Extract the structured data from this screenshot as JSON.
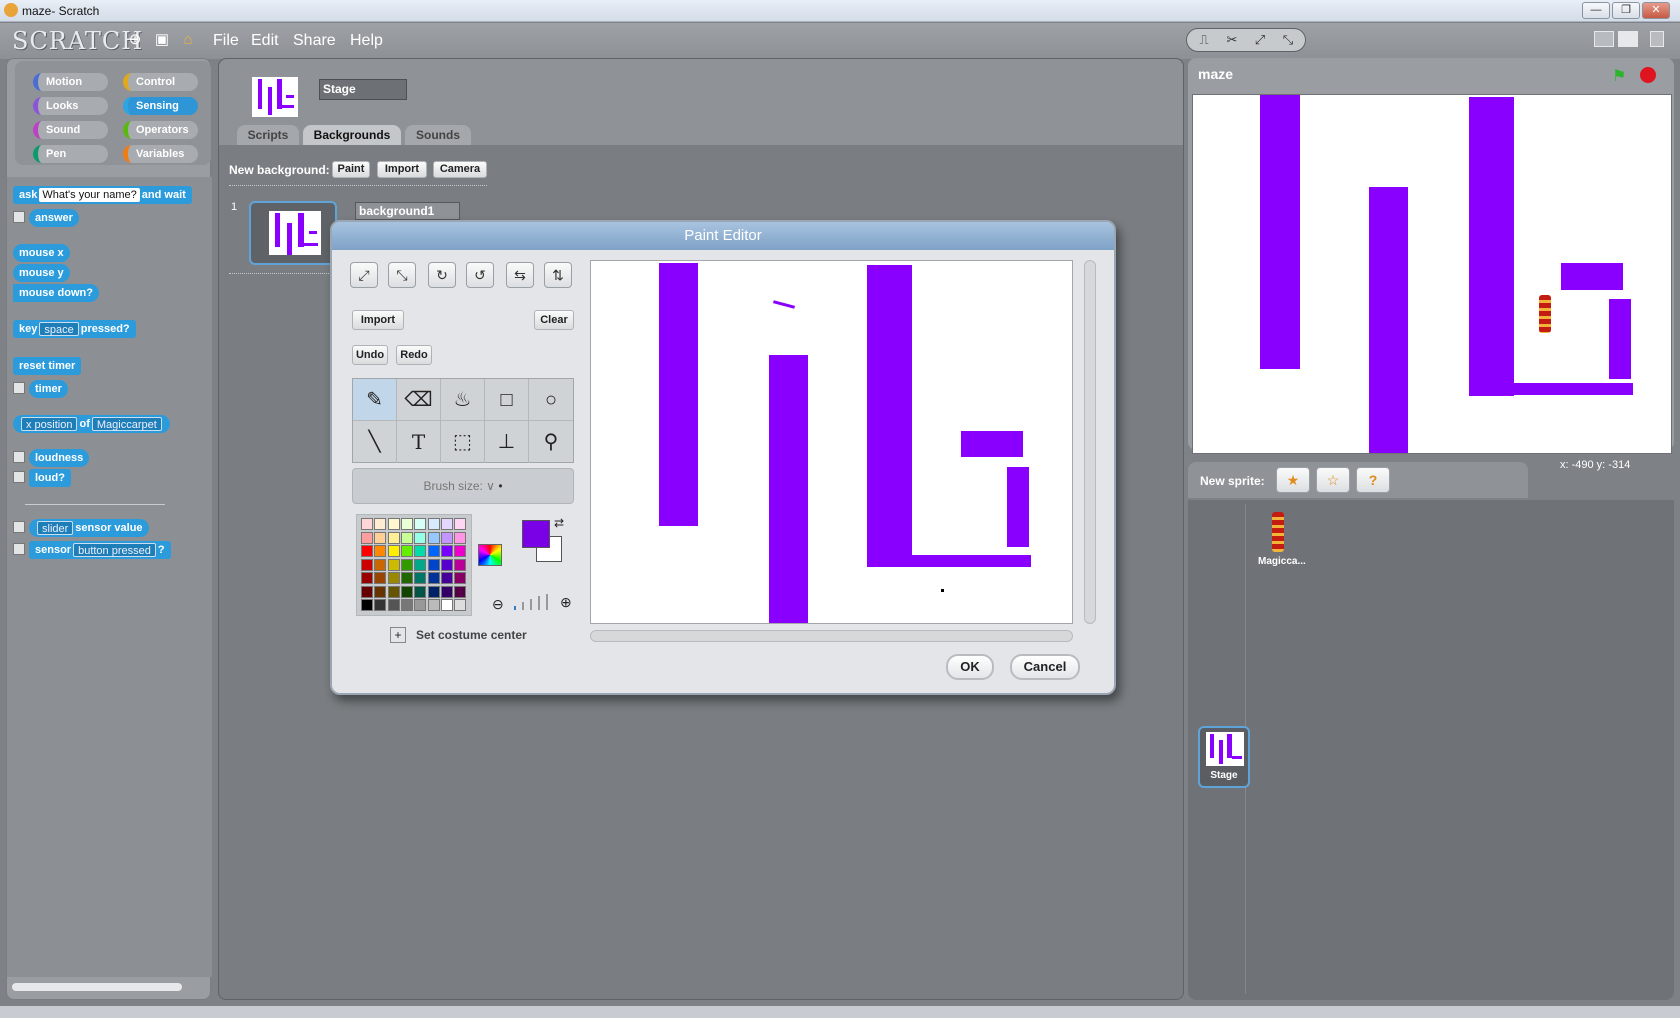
{
  "window": {
    "title": "maze- Scratch",
    "min": "—",
    "max": "❐",
    "close": "✕"
  },
  "menu": {
    "logo": "SCRATCH",
    "items": [
      "File",
      "Edit",
      "Share",
      "Help"
    ],
    "icons": [
      "globe-icon",
      "save-icon",
      "share-icon"
    ],
    "tools": [
      "stamp-icon",
      "cut-icon",
      "grow-icon",
      "shrink-icon"
    ]
  },
  "categories": [
    {
      "label": "Motion",
      "color": "#4a6cd4"
    },
    {
      "label": "Control",
      "color": "#e1a91a"
    },
    {
      "label": "Looks",
      "color": "#8a55d7"
    },
    {
      "label": "Sensing",
      "color": "#2ca5e2"
    },
    {
      "label": "Sound",
      "color": "#bb42c3"
    },
    {
      "label": "Operators",
      "color": "#5cb712"
    },
    {
      "label": "Pen",
      "color": "#0e9a6c"
    },
    {
      "label": "Variables",
      "color": "#ee7d16"
    }
  ],
  "blocks": {
    "ask": "ask",
    "ask_default": "What's your name?",
    "and_wait": "and wait",
    "answer": "answer",
    "mouse_x": "mouse x",
    "mouse_y": "mouse y",
    "mouse_down": "mouse down?",
    "key": "key",
    "key_opt": "space",
    "pressed": "pressed?",
    "reset_timer": "reset timer",
    "timer": "timer",
    "attr_opt": "x position",
    "of": "of",
    "sprite_opt": "Magiccarpet",
    "loudness": "loudness",
    "loud": "loud?",
    "slider_opt": "slider",
    "sensor_value": "sensor value",
    "sensor": "sensor",
    "sensor_opt": "button pressed",
    "question": "?"
  },
  "center": {
    "stage_name": "Stage",
    "tabs": [
      "Scripts",
      "Backgrounds",
      "Sounds"
    ],
    "active_tab": "Backgrounds",
    "new_background_label": "New background:",
    "new_bg_buttons": [
      "Paint",
      "Import",
      "Camera"
    ],
    "costume_number": "1",
    "costume_name": "background1"
  },
  "editor": {
    "title": "Paint Editor",
    "import": "Import",
    "clear": "Clear",
    "undo": "Undo",
    "redo": "Redo",
    "brush_label": "Brush size: ∨",
    "set_center": "Set costume center",
    "ok": "OK",
    "cancel": "Cancel",
    "fg_color": "#7a00e6",
    "bg_color": "#ffffff",
    "active_tool": "paintbrush"
  },
  "stage": {
    "project_name": "maze",
    "coords": "x: -490   y: -314"
  },
  "sprites": {
    "new_sprite_label": "New sprite:",
    "sprite_name": "Magicca...",
    "stage_label": "Stage"
  },
  "colors": {
    "accent": "#2b9bdc",
    "maze": "#8a00ff",
    "window": "#7e8286"
  }
}
